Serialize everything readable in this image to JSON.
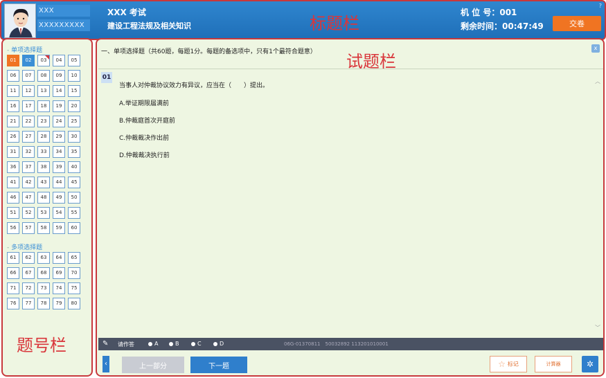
{
  "header": {
    "user_name": "XXX",
    "user_id": "XXXXXXXXX",
    "exam_title": "XXX 考试",
    "exam_subject": "建设工程法规及相关知识",
    "section_label": "标题栏",
    "machine_label": "机 位 号：001",
    "remaining_label": "剩余时间：00:47:49",
    "submit_label": "交卷",
    "help_glyph": "?"
  },
  "nav": {
    "single_group_title": "单项选择题",
    "multi_group_title": "多项选择题",
    "section_label": "题号栏",
    "single_questions": [
      "01",
      "02",
      "03",
      "04",
      "05",
      "06",
      "07",
      "08",
      "09",
      "10",
      "11",
      "12",
      "13",
      "14",
      "15",
      "16",
      "17",
      "18",
      "19",
      "20",
      "21",
      "22",
      "23",
      "24",
      "25",
      "26",
      "27",
      "28",
      "29",
      "30",
      "31",
      "32",
      "33",
      "34",
      "35",
      "36",
      "37",
      "38",
      "39",
      "40",
      "41",
      "42",
      "43",
      "44",
      "45",
      "46",
      "47",
      "48",
      "49",
      "50",
      "51",
      "52",
      "53",
      "54",
      "55",
      "56",
      "57",
      "58",
      "59",
      "60"
    ],
    "multi_questions": [
      "61",
      "62",
      "63",
      "64",
      "65",
      "66",
      "67",
      "68",
      "69",
      "70",
      "71",
      "72",
      "73",
      "74",
      "75",
      "76",
      "77",
      "78",
      "79",
      "80"
    ],
    "current": "01",
    "answered": [
      "02"
    ],
    "flagged": [
      "03"
    ]
  },
  "question": {
    "instruction": "一、单项选择题（共60题，每题1分。每题的备选项中，只有1个最符合题意）",
    "section_label": "试题栏",
    "number": "01",
    "text": "当事人对仲裁协议效力有异议，应当在（　　）提出。",
    "options": [
      "A.举证期限届满前",
      "B.仲裁庭首次开庭前",
      "C.仲裁裁决作出前",
      "D.仲裁裁决执行前"
    ]
  },
  "answer_bar": {
    "label": "请作答",
    "choices": [
      "A",
      "B",
      "C",
      "D"
    ],
    "code": "06G-01370811　50032892 113201010001"
  },
  "controls": {
    "prev_label": "上一部分",
    "next_label": "下一题",
    "mark_label": "标记",
    "calc_label": "计算器"
  },
  "colors": {
    "accent_blue": "#2f7fcc",
    "accent_orange": "#f07422",
    "annotation_red": "#d9363b",
    "panel_bg": "#eef6e2"
  }
}
